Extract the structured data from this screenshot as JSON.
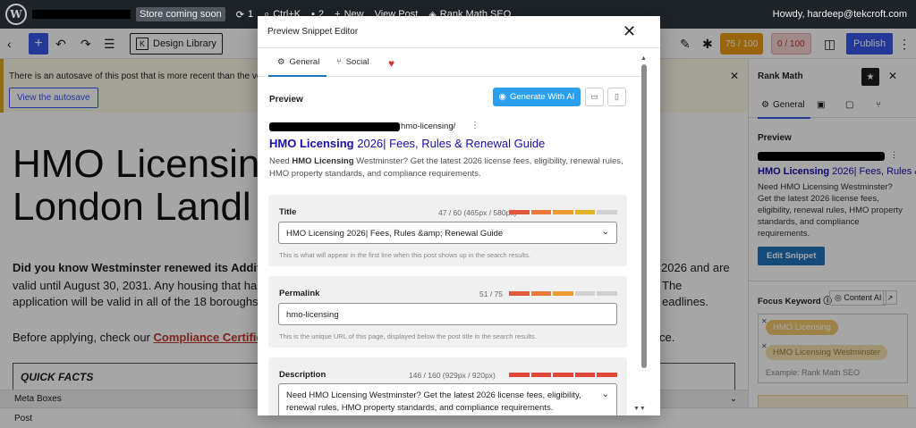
{
  "adminbar": {
    "store_badge": "Store coming soon",
    "updates_count": "1",
    "search_shortcut": "Ctrl+K",
    "comments_count": "2",
    "new_label": "New",
    "view_post_label": "View Post",
    "rankmath_label": "Rank Math SEO",
    "howdy": "Howdy, hardeep@tekcroft.com"
  },
  "toolbar": {
    "design_library_label": "Design Library",
    "seo_score": "75 / 100",
    "readability_score": "0 / 100",
    "publish_label": "Publish"
  },
  "notice": {
    "message": "There is an autosave of this post that is more recent than the version bel",
    "view_autosave_label": "View the autosave"
  },
  "content": {
    "title_line1": "HMO Licensin",
    "title_line2": "London Landl",
    "p1_bold": "Did you know Westminster renewed its Additio",
    "p1_right": "2026 and are",
    "p2": "valid until August 30, 2031. Any housing that has",
    "p2_right": "The",
    "p3": "application will be valid in all of the 18 boroughs",
    "p3_right": "eadlines.",
    "p4_start": "Before applying, check our ",
    "p4_link": "Compliance Certific",
    "p4_right": "ce.",
    "quick_facts": "QUICK FACTS"
  },
  "meta_boxes_label": "Meta Boxes",
  "footer_label": "Post",
  "sidebar": {
    "title": "Rank Math",
    "tab_general": "General",
    "preview_label": "Preview",
    "serp_title_bold": "HMO Licensing",
    "serp_title_rest": " 2026| Fees, Rules &",
    "serp_desc": "Need HMO Licensing Westminster? Get the latest 2026 license fees, eligibility, renewal rules, HMO property standards, and compliance requirements.",
    "edit_snippet_label": "Edit Snippet",
    "focus_keyword_label": "Focus Keyword",
    "content_ai_label": "Content AI",
    "keywords": [
      "HMO Licensing",
      "HMO Licensing Westminster"
    ],
    "keyword_placeholder": "Example: Rank Math SEO"
  },
  "modal": {
    "title": "Preview Snippet Editor",
    "tab_general": "General",
    "tab_social": "Social",
    "preview_label": "Preview",
    "generate_ai_label": "Generate With AI",
    "url_suffix": "hmo-licensing/",
    "serp_title_bold": "HMO Licensing",
    "serp_title_rest": " 2026| Fees, Rules & Renewal Guide",
    "serp_desc_prefix": "Need ",
    "serp_desc_bold1": "HMO Licensing",
    "serp_desc_mid": " Westminster? Get the latest 2026 license fees, eligibility, renewal rules, HMO property standards, and compliance requirements.",
    "title_field": {
      "label": "Title",
      "count": "47 / 60 (465px / 580px)",
      "value": "HMO Licensing 2026| Fees, Rules &amp; Renewal Guide",
      "help": "This is what will appear in the first line when this post shows up in the search results.",
      "meter_fill": 0.8
    },
    "permalink_field": {
      "label": "Permalink",
      "count": "51 / 75",
      "value": "hmo-licensing",
      "help": "This is the unique URL of this page, displayed below the post title in the search results.",
      "meter_fill": 0.67
    },
    "description_field": {
      "label": "Description",
      "count": "146 / 160 (929px / 920px)",
      "value": "Need HMO Licensing Westminster? Get the latest 2026 license fees, eligibility, renewal rules, HMO property standards, and compliance requirements.",
      "meter_fill": 1.0
    }
  },
  "colors": {
    "accent": "#3858e9",
    "seo_score": "#ed9a10",
    "link_blue": "#1a0dab",
    "ai_button": "#2a9ff0",
    "heart": "#d63638"
  }
}
